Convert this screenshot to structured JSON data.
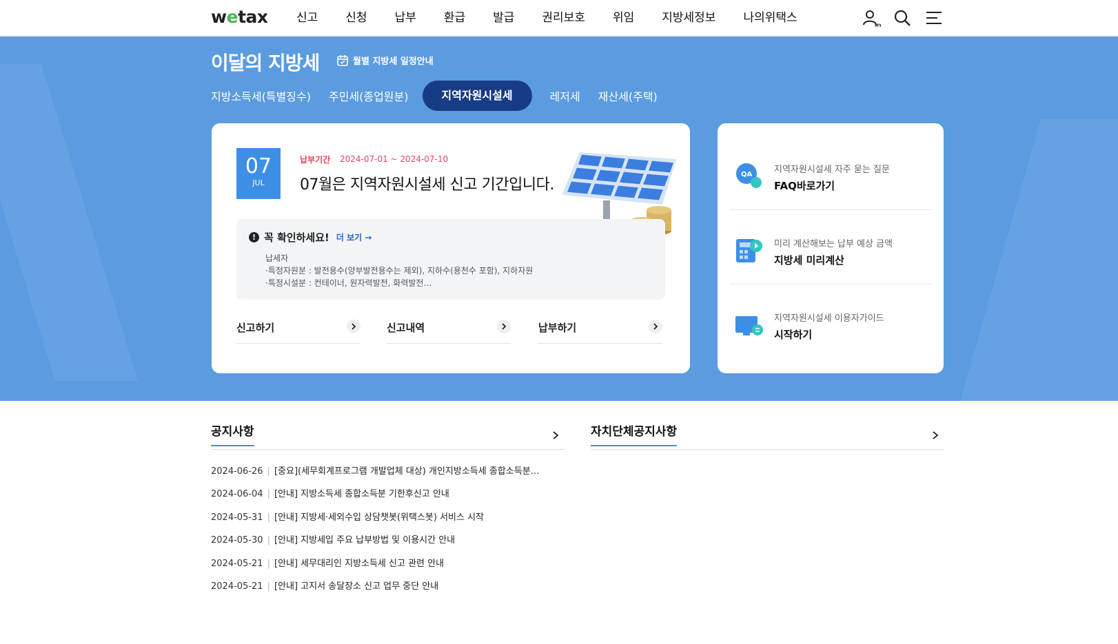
{
  "header": {
    "logo": "wetax",
    "nav": [
      "신고",
      "신청",
      "납부",
      "환급",
      "발급",
      "권리보호",
      "위임",
      "지방세정보",
      "나의위택스"
    ]
  },
  "hero": {
    "title": "이달의 지방세",
    "schedule_link": "월별 지방세 일정안내",
    "tabs": [
      "지방소득세(특별징수)",
      "주민세(종업원분)",
      "지역자원시설세",
      "레저세",
      "재산세(주택)"
    ],
    "active_tab": "지역자원시설세"
  },
  "card": {
    "day": "07",
    "month": "JUL",
    "pay_label": "납부기간",
    "pay_period": "2024-07-01 ~ 2024-07-10",
    "headline": "07월은 지역자원시설세 신고 기간입니다.",
    "check_title": "꼭 확인하세요!",
    "more_label": "더 보기",
    "lines": [
      "납세자",
      "·특정자원분 : 발전용수(양부발전용수는 제외), 지하수(용천수 포함), 지하자원",
      "·특정시설분 : 컨테이너, 원자력발전, 화력발전…"
    ],
    "actions": [
      "신고하기",
      "신고내역",
      "납부하기"
    ]
  },
  "side": [
    {
      "sub": "지역자원시설세 자주 묻는 질문",
      "main": "FAQ바로가기",
      "icon": "qa-icon"
    },
    {
      "sub": "미리 계산해보는 납부 예상 금액",
      "main": "지방세 미리계산",
      "icon": "calculator-icon"
    },
    {
      "sub": "지역자원시설세 이용자가이드",
      "main": "시작하기",
      "icon": "monitor-guide-icon"
    }
  ],
  "notices": {
    "title": "공지사항",
    "items": [
      {
        "date": "2024-06-26",
        "text": "[중요](세무회계프로그램 개발업체 대상) 개인지방소득세 종합소득분…"
      },
      {
        "date": "2024-06-04",
        "text": "[안내] 지방소득세 종합소득분 기한후신고 안내"
      },
      {
        "date": "2024-05-31",
        "text": "[안내] 지방세·세외수입 상담챗봇(위택스봇) 서비스 시작"
      },
      {
        "date": "2024-05-30",
        "text": "[안내] 지방세입 주요 납부방법 및 이용시간 안내"
      },
      {
        "date": "2024-05-21",
        "text": "[안내] 세무대리인 지방소득세 신고 관련 안내"
      },
      {
        "date": "2024-05-21",
        "text": "[안내] 고지서 송달장소 신고 업무 중단 안내"
      }
    ]
  },
  "local_notices": {
    "title": "자치단체공지사항"
  },
  "colors": {
    "hero_bg": "#5b9be0",
    "active_tab": "#173c84",
    "accent": "#3d8fe6",
    "pay_period": "#e8425c"
  }
}
